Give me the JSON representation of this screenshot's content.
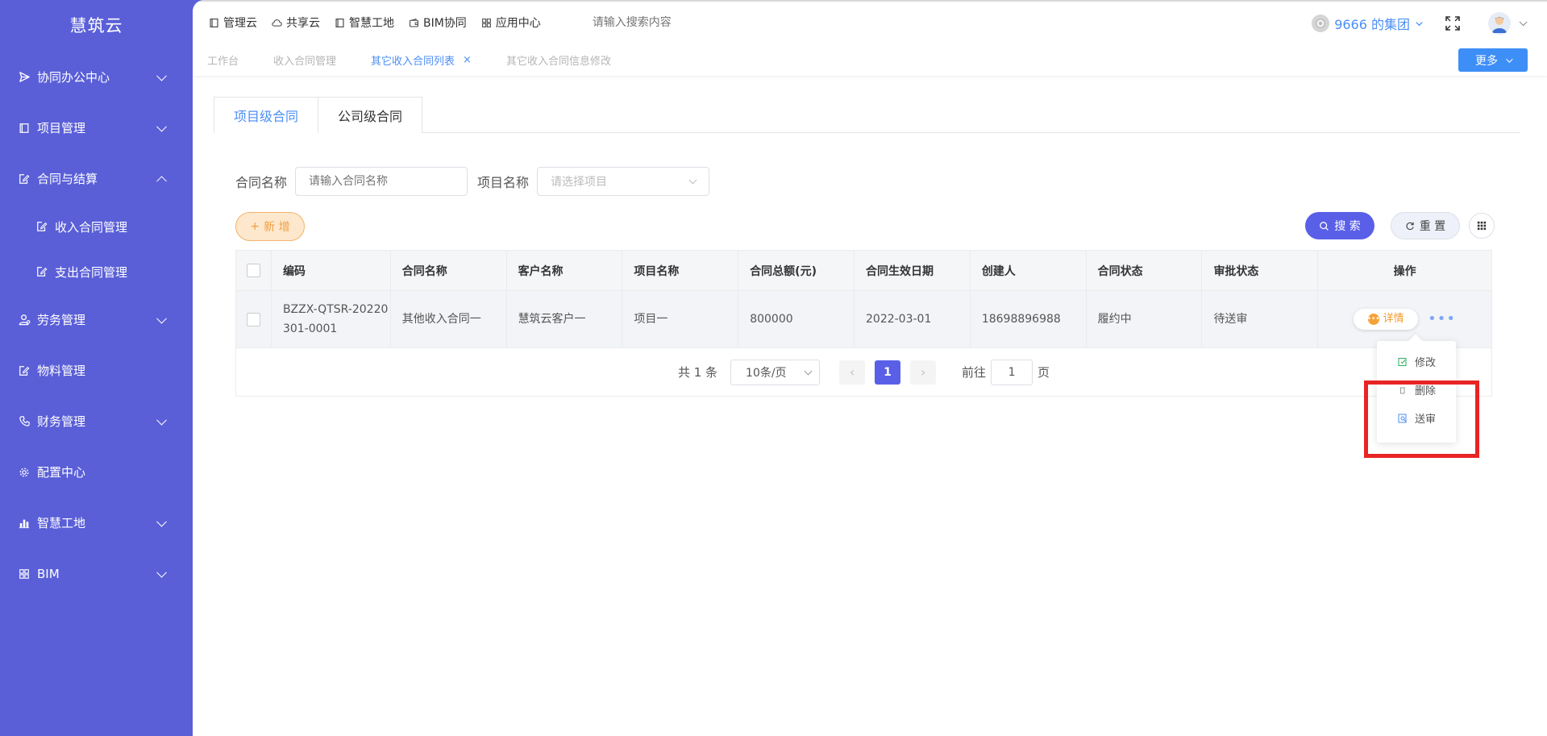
{
  "sidebar": {
    "brand": "慧筑云",
    "items": [
      {
        "label": "协同办公中心",
        "icon": "send-icon",
        "chevron": "down"
      },
      {
        "label": "项目管理",
        "icon": "book-icon",
        "chevron": "down"
      },
      {
        "label": "合同与结算",
        "icon": "edit-doc-icon",
        "chevron": "up"
      },
      {
        "label": "劳务管理",
        "icon": "worker-icon",
        "chevron": "down"
      },
      {
        "label": "物料管理",
        "icon": "edit-doc-icon",
        "chevron": "none"
      },
      {
        "label": "财务管理",
        "icon": "phone-icon",
        "chevron": "down"
      },
      {
        "label": "配置中心",
        "icon": "gear-icon",
        "chevron": "none"
      },
      {
        "label": "智慧工地",
        "icon": "bar-chart-icon",
        "chevron": "down"
      },
      {
        "label": "BIM",
        "icon": "grid-icon",
        "chevron": "down"
      }
    ],
    "subitems": [
      {
        "label": "收入合同管理",
        "icon": "edit-doc-icon"
      },
      {
        "label": "支出合同管理",
        "icon": "edit-doc-icon"
      }
    ]
  },
  "topbar": {
    "nav": [
      {
        "label": "管理云",
        "icon": "book-icon"
      },
      {
        "label": "共享云",
        "icon": "cloud-icon"
      },
      {
        "label": "智慧工地",
        "icon": "book-icon"
      },
      {
        "label": "BIM协同",
        "icon": "wallet-icon"
      },
      {
        "label": "应用中心",
        "icon": "grid-icon"
      }
    ],
    "search_placeholder": "请输入搜索内容",
    "org_name": "9666 的集团"
  },
  "tagsbar": {
    "tags": [
      {
        "label": "工作台",
        "active": false
      },
      {
        "label": "收入合同管理",
        "active": false
      },
      {
        "label": "其它收入合同列表",
        "active": true
      },
      {
        "label": "其它收入合同信息修改",
        "active": false
      }
    ],
    "close_symbol": "×",
    "more_label": "更多"
  },
  "tabs": [
    {
      "label": "项目级合同",
      "active": true
    },
    {
      "label": "公司级合同",
      "active": false
    }
  ],
  "filters": {
    "contract_name_label": "合同名称",
    "contract_name_placeholder": "请输入合同名称",
    "project_name_label": "项目名称",
    "project_name_placeholder": "请选择项目"
  },
  "actions": {
    "add_label": "新 增",
    "add_symbol": "+",
    "search_label": "搜 索",
    "reset_label": "重 置"
  },
  "table": {
    "headers": [
      "编码",
      "合同名称",
      "客户名称",
      "项目名称",
      "合同总额(元)",
      "合同生效日期",
      "创建人",
      "合同状态",
      "审批状态",
      "操作"
    ],
    "rows": [
      {
        "code": "BZZX-QTSR-20220301-0001",
        "contract_name": "其他收入合同一",
        "customer": "慧筑云客户一",
        "project": "项目一",
        "amount": "800000",
        "effective_date": "2022-03-01",
        "creator": "18698896988",
        "contract_status": "履约中",
        "approval_status": "待送审",
        "detail_label": "详情",
        "more_symbol": "•••"
      }
    ]
  },
  "pagination": {
    "total_text": "共 1 条",
    "page_size": "10条/页",
    "prev_symbol": "‹",
    "next_symbol": "›",
    "current_page": "1",
    "goto_prefix": "前往",
    "goto_value": "1",
    "goto_suffix": "页"
  },
  "row_menu": {
    "items": [
      {
        "label": "修改",
        "icon": "edit-icon"
      },
      {
        "label": "删除",
        "icon": "trash-icon"
      },
      {
        "label": "送审",
        "icon": "submit-review-icon"
      }
    ]
  },
  "colors": {
    "sidebar_bg": "#5a5fd8",
    "accent_blue": "#4b8ef5",
    "primary_button": "#5a5fe8",
    "add_button_bg": "#fde7cd",
    "add_button_text": "#f0a040",
    "highlight_border": "#e82424"
  }
}
